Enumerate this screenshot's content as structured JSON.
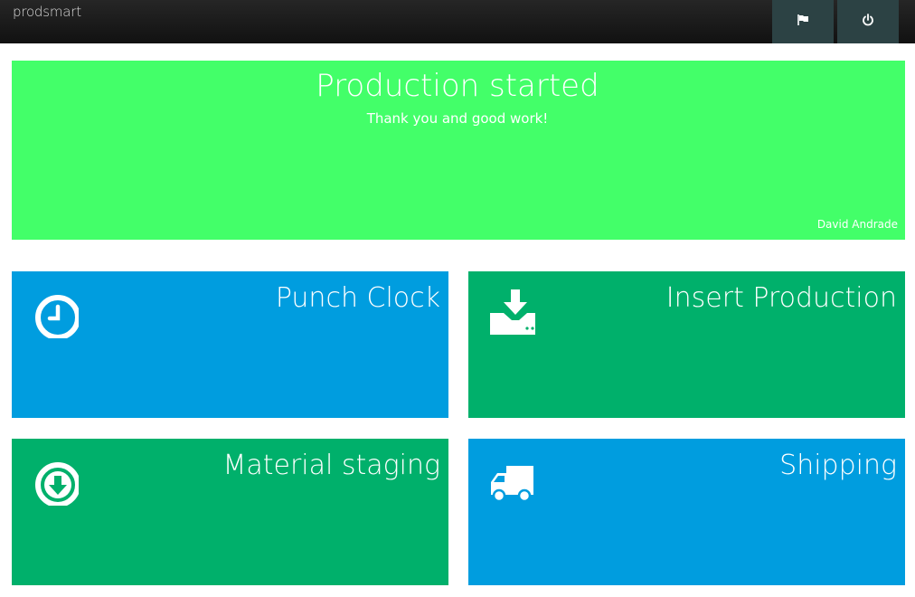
{
  "header": {
    "brand": "prodsmart",
    "buttons": [
      {
        "icon": "flag-icon"
      },
      {
        "icon": "power-icon"
      }
    ]
  },
  "banner": {
    "title": "Production started",
    "subtitle": "Thank you and good work!",
    "user": "David Andrade",
    "color": "#43ff69"
  },
  "tiles": [
    {
      "label": "Punch Clock",
      "icon": "clock-icon",
      "color": "#009ddf"
    },
    {
      "label": "Insert Production",
      "icon": "download-tray-icon",
      "color": "#00b06b"
    },
    {
      "label": "Material staging",
      "icon": "arrow-down-circle-icon",
      "color": "#00b06b"
    },
    {
      "label": "Shipping",
      "icon": "truck-icon",
      "color": "#009ddf"
    }
  ]
}
